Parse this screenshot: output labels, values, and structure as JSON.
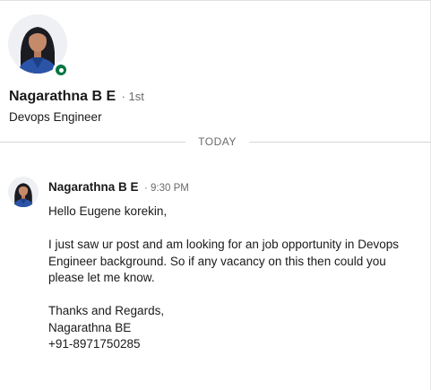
{
  "profile": {
    "name": "Nagarathna B E",
    "degree": "· 1st",
    "headline": "Devops Engineer",
    "presence_color": "#057642"
  },
  "divider": {
    "label": "TODAY"
  },
  "message": {
    "sender": "Nagarathna B E",
    "time": "· 9:30 PM",
    "greeting": "Hello Eugene korekin,",
    "paragraph_line1": "I just saw ur post and am looking for an job opportunity in Devops",
    "paragraph_line2": "Engineer background. So if any vacancy on this then could you",
    "paragraph_line3": "please let me know.",
    "signoff": "Thanks and Regards,",
    "signature_name": "Nagarathna BE",
    "signature_phone": "+91-8971750285"
  }
}
